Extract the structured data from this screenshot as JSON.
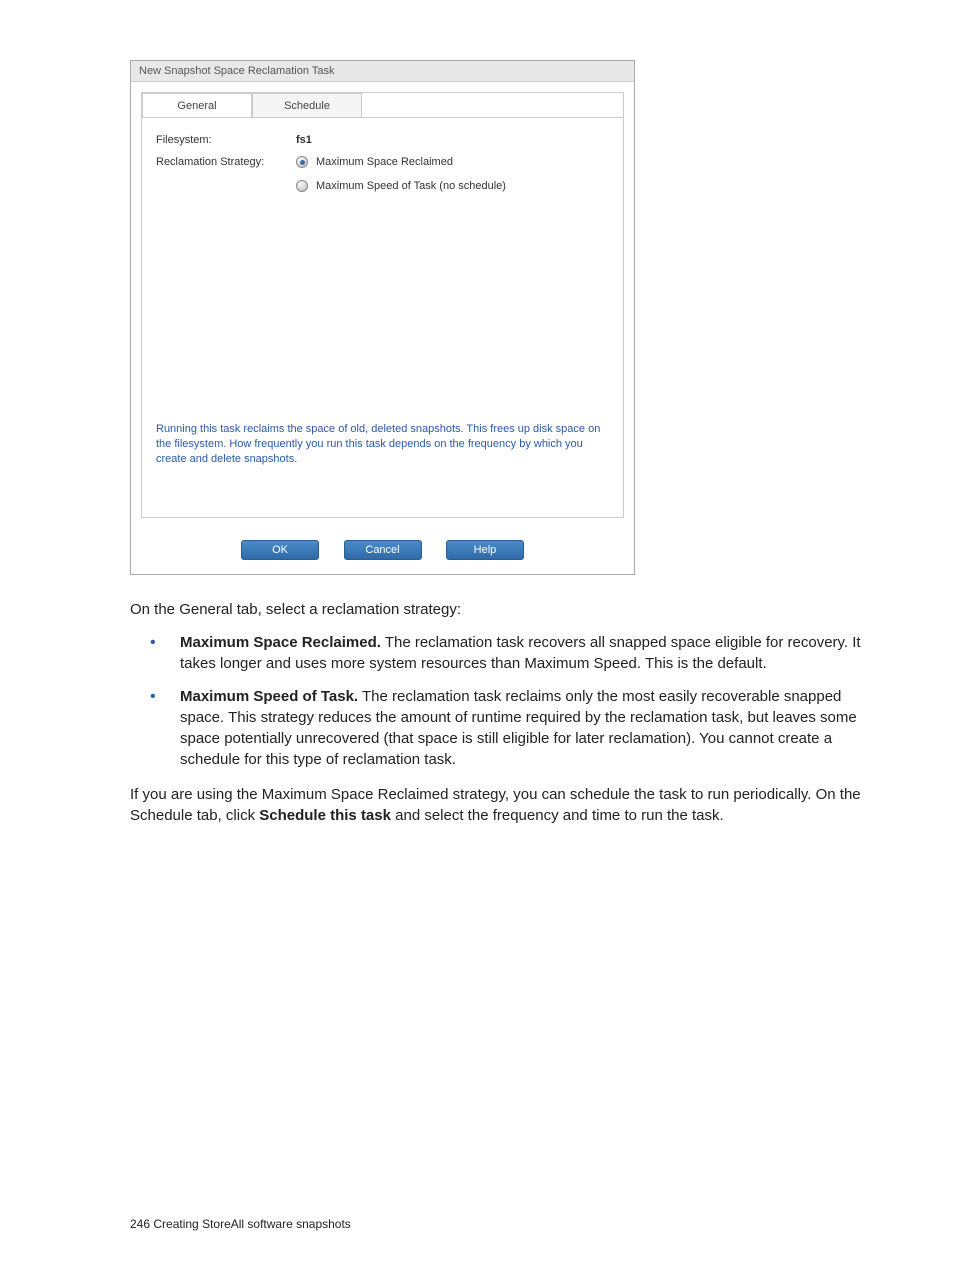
{
  "dialog": {
    "title": "New Snapshot Space Reclamation Task",
    "tabs": {
      "general": "General",
      "schedule": "Schedule"
    },
    "filesystem_label": "Filesystem:",
    "filesystem_value": "fs1",
    "strategy_label": "Reclamation Strategy:",
    "radios": {
      "max_space": "Maximum Space Reclaimed",
      "max_speed": "Maximum Speed of Task (no schedule)"
    },
    "info": "Running this task reclaims the space of old, deleted snapshots. This frees up disk space on the filesystem. How frequently you run this task depends on the frequency by which you create and delete snapshots.",
    "buttons": {
      "ok": "OK",
      "cancel": "Cancel",
      "help": "Help"
    }
  },
  "doc": {
    "intro": "On the General tab, select a reclamation strategy:",
    "bullet1_title": "Maximum Space Reclaimed.",
    "bullet1_text": " The reclamation task recovers all snapped space eligible for recovery. It takes longer and uses more system resources than Maximum Speed. This is the default.",
    "bullet2_title": "Maximum Speed of Task.",
    "bullet2_text": " The reclamation task reclaims only the most easily recoverable snapped space. This strategy reduces the amount of runtime required by the reclamation task, but leaves some space potentially unrecovered (that space is still eligible for later reclamation). You cannot create a schedule for this type of reclamation task.",
    "schedule_para_a": "If you are using the Maximum Space Reclaimed strategy, you can schedule the task to run periodically. On the Schedule tab, click ",
    "schedule_para_bold": "Schedule this task",
    "schedule_para_b": " and select the frequency and time to run the task."
  },
  "footer": {
    "page": "246",
    "sep": "   ",
    "section": "Creating StoreAll software snapshots"
  }
}
